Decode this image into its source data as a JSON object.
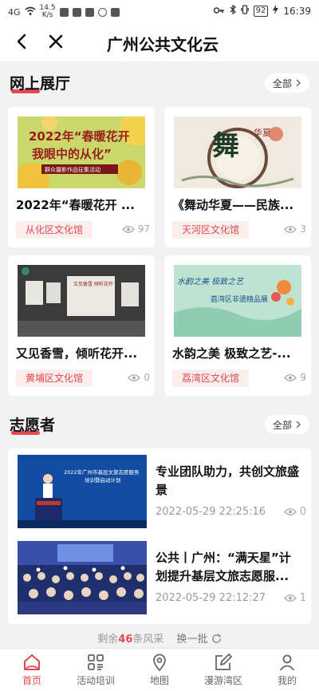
{
  "status_bar": {
    "signal": "4G",
    "speed_value": "14.5",
    "speed_unit": "K/s",
    "battery": "92",
    "time": "16:39"
  },
  "nav": {
    "title": "广州公共文化云"
  },
  "exhibitions": {
    "title": "网上展厅",
    "all_label": "全部",
    "items": [
      {
        "title": "2022年“春暖花开 ...",
        "tag": "从化区文化馆",
        "views": "97",
        "poster_line1": "2022年“春暖花开",
        "poster_line2": "我眼中的从化”",
        "poster_line3": "群众摄影作品征集活动"
      },
      {
        "title": "《舞动华夏——民族...",
        "tag": "天河区文化馆",
        "views": "3",
        "poster_line1": "舞",
        "poster_line2": "华夏"
      },
      {
        "title": "又见香雪，倾听花开...",
        "tag": "黄埔区文化馆",
        "views": "0",
        "poster_line1": "又见香雪 倾听花开"
      },
      {
        "title": "水韵之美 极致之艺-...",
        "tag": "荔湾区文化馆",
        "views": "9",
        "poster_line1": "水韵之美  极致之艺",
        "poster_line2": "荔湾区非遗精品展"
      }
    ]
  },
  "volunteers": {
    "title": "志愿者",
    "all_label": "全部",
    "items": [
      {
        "title": "专业团队助力，共创文旅盛景",
        "date": "2022-05-29 22:25:16",
        "views": "0",
        "banner_line1": "2022年广州市基层文旅志愿服务",
        "banner_line2": "培训暨启动计划"
      },
      {
        "title": "公共丨广州：“满天星”计划提升基层文旅志愿服...",
        "date": "2022-05-29 22:12:27",
        "views": "1"
      }
    ]
  },
  "more": {
    "prefix": "剩余",
    "count": "46",
    "suffix": "条风采",
    "refresh": "换一批"
  },
  "tabs": [
    {
      "label": "首页",
      "icon": "home-icon"
    },
    {
      "label": "活动培训",
      "icon": "grid-icon"
    },
    {
      "label": "地图",
      "icon": "map-pin-icon"
    },
    {
      "label": "漫游湾区",
      "icon": "edit-icon"
    },
    {
      "label": "我的",
      "icon": "user-icon"
    }
  ],
  "colors": {
    "accent": "#e0474f",
    "tag_bg": "#fdeeee",
    "page_bg": "#f2f2f2"
  }
}
